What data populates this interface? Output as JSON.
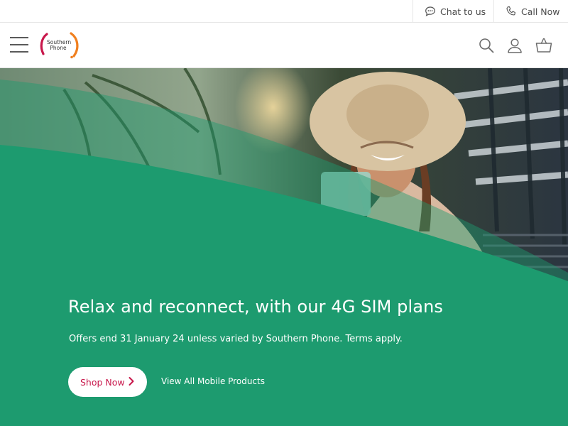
{
  "utility_bar": {
    "chat_label": "Chat to us",
    "call_label": "Call Now"
  },
  "header": {
    "logo_text_line1": "Southern",
    "logo_text_line2": "Phone"
  },
  "hero": {
    "headline": "Relax and reconnect, with our 4G SIM plans",
    "subtext": "Offers end 31 January 24 unless varied by Southern Phone. Terms apply.",
    "primary_button": "Shop Now",
    "secondary_link": "View All Mobile Products"
  },
  "colors": {
    "brand_green": "#1d9b6f",
    "brand_red": "#c8174b",
    "brand_orange": "#f07f1e"
  },
  "icons": [
    "chat-bubble-icon",
    "phone-icon",
    "hamburger-menu-icon",
    "search-icon",
    "user-icon",
    "basket-icon",
    "chevron-right-icon"
  ]
}
